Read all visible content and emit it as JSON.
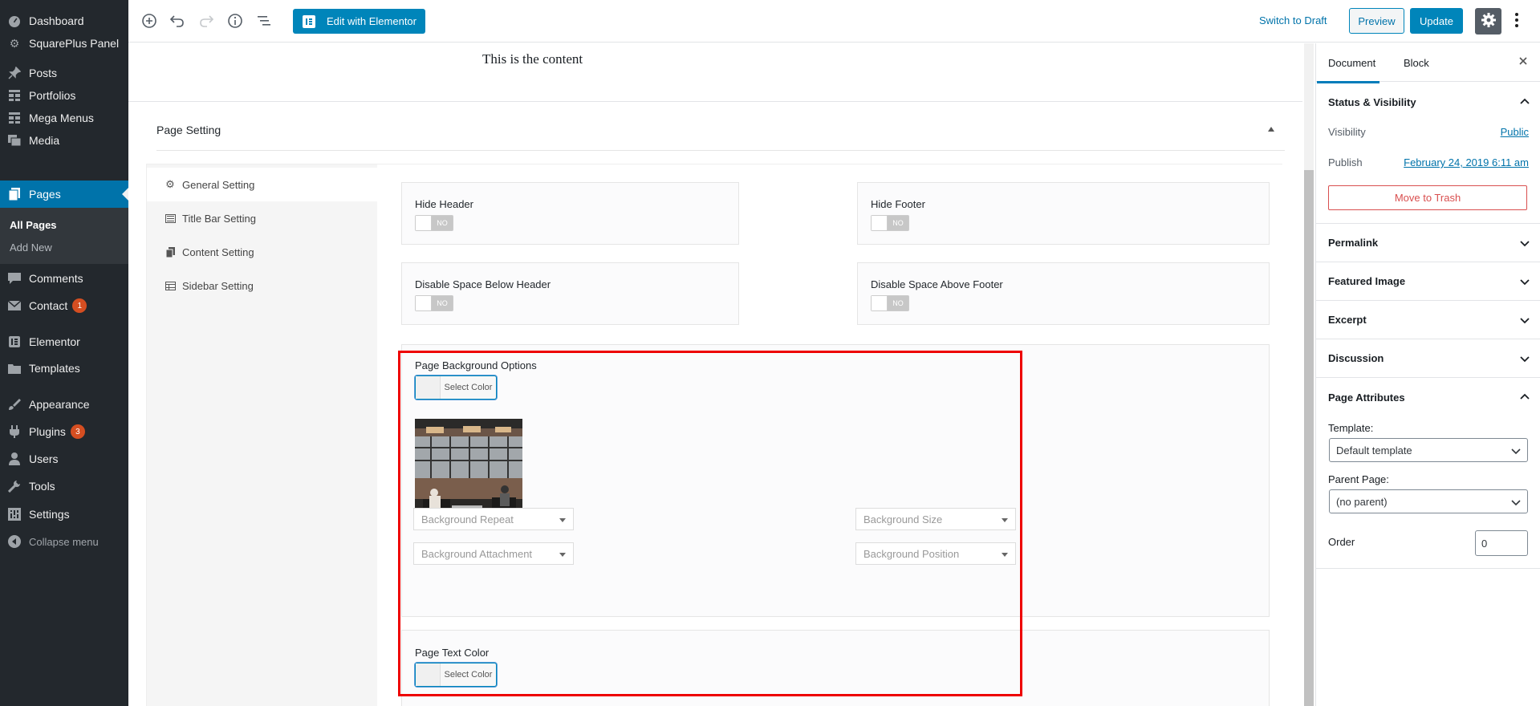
{
  "admin_menu": {
    "items": [
      {
        "label": "Dashboard",
        "icon": "dashboard-icon"
      },
      {
        "label": "SquarePlus Panel",
        "icon": "gear-icon"
      },
      {
        "label": "Posts",
        "icon": "pin-icon"
      },
      {
        "label": "Portfolios",
        "icon": "grid-icon"
      },
      {
        "label": "Mega Menus",
        "icon": "grid-icon"
      },
      {
        "label": "Media",
        "icon": "media-icon"
      },
      {
        "label": "Pages",
        "icon": "pages-icon"
      },
      {
        "label": "Comments",
        "icon": "comment-icon"
      },
      {
        "label": "Contact",
        "icon": "mail-icon",
        "badge": "1"
      },
      {
        "label": "Elementor",
        "icon": "elementor-icon"
      },
      {
        "label": "Templates",
        "icon": "folder-icon"
      },
      {
        "label": "Appearance",
        "icon": "brush-icon"
      },
      {
        "label": "Plugins",
        "icon": "plugin-icon",
        "badge": "3"
      },
      {
        "label": "Users",
        "icon": "user-icon"
      },
      {
        "label": "Tools",
        "icon": "wrench-icon"
      },
      {
        "label": "Settings",
        "icon": "settings-icon"
      }
    ],
    "pages_submenu": [
      "All Pages",
      "Add New"
    ],
    "collapse_label": "Collapse menu"
  },
  "toolbar": {
    "elementor_label": "Edit with Elementor",
    "switch_draft_label": "Switch to Draft",
    "preview_label": "Preview",
    "update_label": "Update"
  },
  "editor": {
    "content_text": "This is the content"
  },
  "page_setting": {
    "title": "Page Setting",
    "tabs": [
      "General Setting",
      "Title Bar Setting",
      "Content Setting",
      "Sidebar Setting"
    ],
    "hide_header_label": "Hide Header",
    "hide_footer_label": "Hide Footer",
    "disable_below_header_label": "Disable Space Below Header",
    "disable_above_footer_label": "Disable Space Above Footer",
    "toggle_label": "NO",
    "bg_options_label": "Page Background Options",
    "select_color_label": "Select Color",
    "bg_repeat_placeholder": "Background Repeat",
    "bg_size_placeholder": "Background Size",
    "bg_attachment_placeholder": "Background Attachment",
    "bg_position_placeholder": "Background Position",
    "text_color_label": "Page Text Color"
  },
  "sidebar": {
    "tab_document": "Document",
    "tab_block": "Block",
    "status_title": "Status & Visibility",
    "visibility_label": "Visibility",
    "visibility_value": "Public",
    "publish_label": "Publish",
    "publish_value": "February 24, 2019 6:11 am",
    "trash_label": "Move to Trash",
    "permalink_title": "Permalink",
    "featured_title": "Featured Image",
    "excerpt_title": "Excerpt",
    "discussion_title": "Discussion",
    "attributes_title": "Page Attributes",
    "template_label": "Template:",
    "template_value": "Default template",
    "parent_label": "Parent Page:",
    "parent_value": "(no parent)",
    "order_label": "Order",
    "order_value": "0"
  },
  "colors": {
    "accent": "#0085ba",
    "admin_bg": "#23282d",
    "highlight_border": "#ee0000"
  }
}
